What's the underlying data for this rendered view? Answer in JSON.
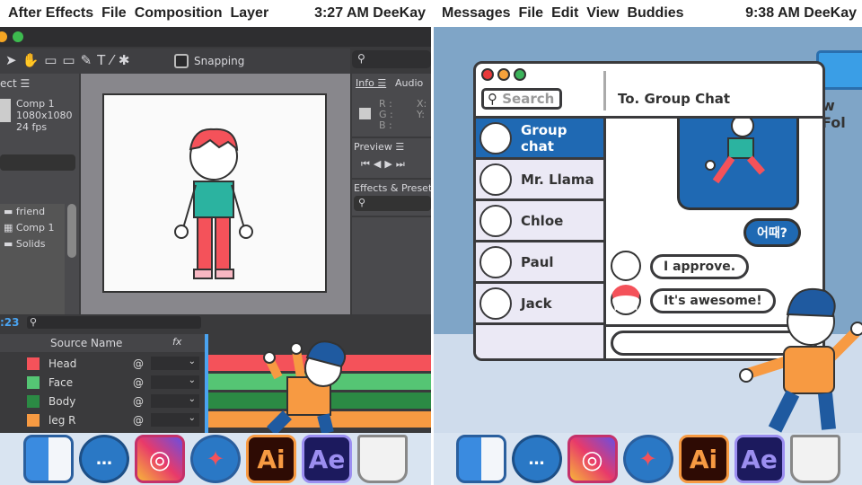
{
  "left_menu": {
    "items": [
      "After Effects",
      "File",
      "Composition",
      "Layer"
    ],
    "time": "3:27 AM",
    "user": "DeeKay"
  },
  "right_menu": {
    "items": [
      "Messages",
      "File",
      "Edit",
      "View",
      "Buddies"
    ],
    "time": "9:38 AM",
    "user": "DeeKay"
  },
  "ae": {
    "toolbar": {
      "snapping": "Snapping"
    },
    "project": {
      "title": "ect ☰",
      "comp_name": "Comp 1",
      "comp_size": "1080x1080",
      "comp_fps": "24 fps",
      "items": [
        "friend",
        "Comp 1",
        "Solids"
      ]
    },
    "info": {
      "tab_info": "Info ☰",
      "tab_audio": "Audio",
      "r": "R :",
      "g": "G :",
      "b": "B :",
      "x": "X:",
      "y": "Y:"
    },
    "preview": {
      "title": "Preview ☰"
    },
    "effects": {
      "title": "Effects & Presets"
    },
    "timeline": {
      "time": ":23",
      "source_name": "Source Name",
      "fx": "fx",
      "layers": [
        {
          "name": "Head",
          "color": "#f4525a"
        },
        {
          "name": "Face",
          "color": "#55c574"
        },
        {
          "name": "Body",
          "color": "#2b8a44"
        },
        {
          "name": "leg R",
          "color": "#f79a42"
        }
      ]
    }
  },
  "messages": {
    "search_placeholder": "Search",
    "to": "To. Group Chat",
    "contacts": [
      {
        "name": "Group chat",
        "selected": true
      },
      {
        "name": "Mr. Llama"
      },
      {
        "name": "Chloe"
      },
      {
        "name": "Paul"
      },
      {
        "name": "Jack"
      }
    ],
    "sent": "어때?",
    "received": [
      {
        "from": "Mr. Llama",
        "text": "I approve."
      },
      {
        "from": "Chloe",
        "text": "It's awesome!"
      }
    ],
    "accent": "#1f69b3"
  },
  "desktop": {
    "folder_label": "w Fol"
  },
  "dock": {
    "ai": "Ai",
    "ae": "Ae"
  }
}
